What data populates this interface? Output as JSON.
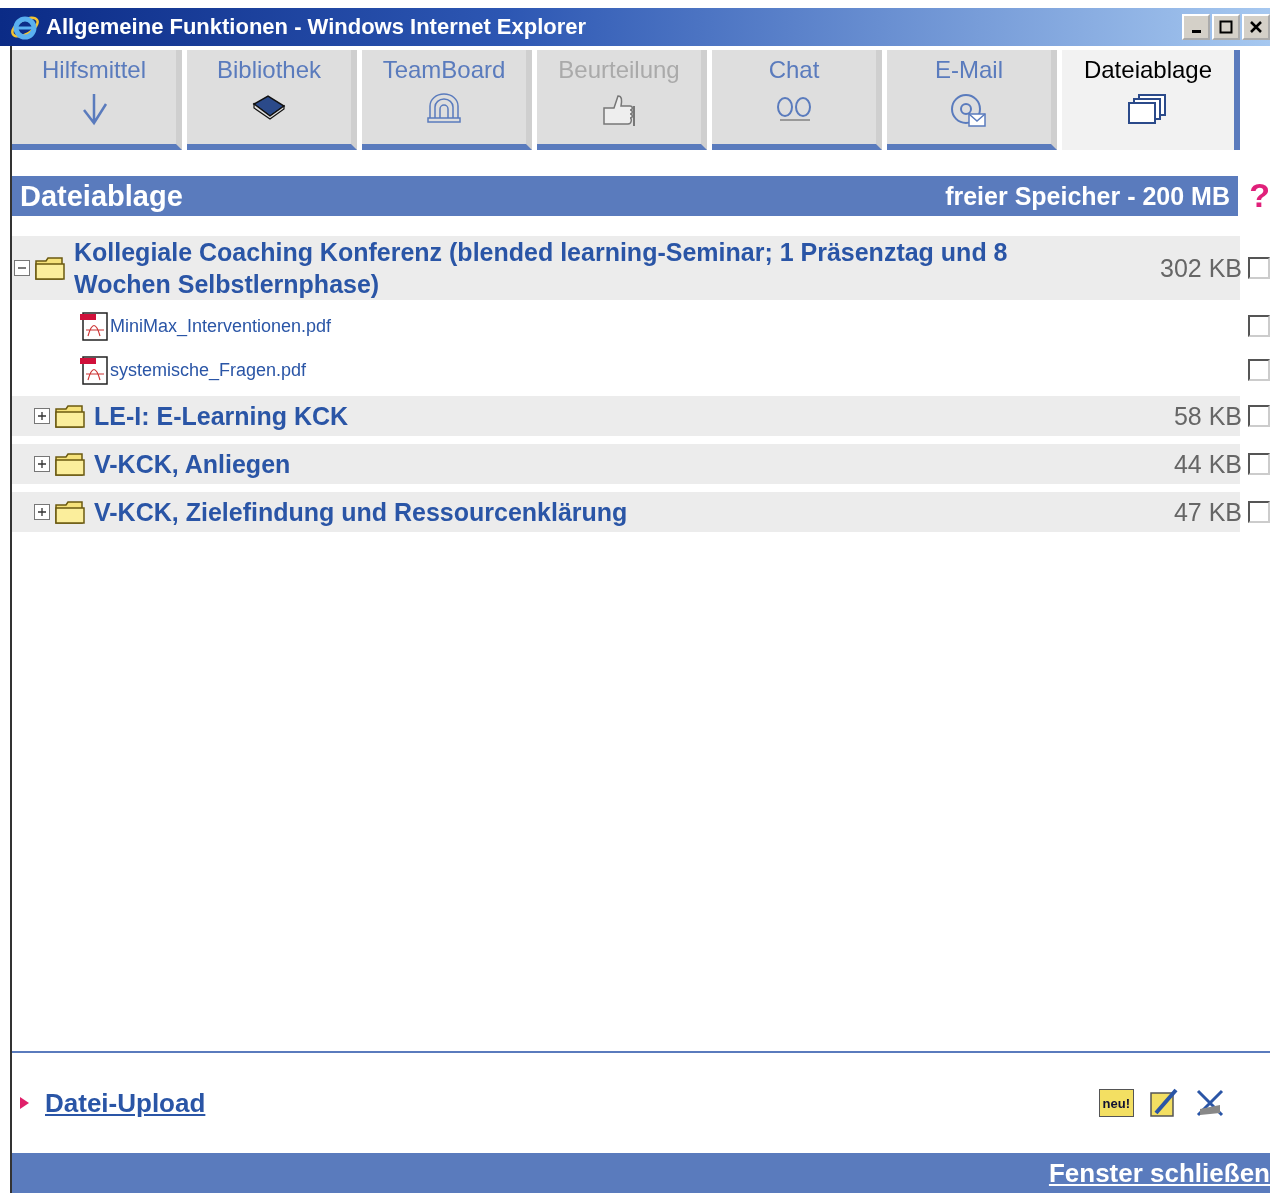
{
  "window": {
    "title": "Allgemeine Funktionen - Windows Internet Explorer"
  },
  "tabs": [
    {
      "label": "Hilfsmittel",
      "selected": false,
      "disabled": false
    },
    {
      "label": "Bibliothek",
      "selected": false,
      "disabled": false
    },
    {
      "label": "TeamBoard",
      "selected": false,
      "disabled": false
    },
    {
      "label": "Beurteilung",
      "selected": false,
      "disabled": true
    },
    {
      "label": "Chat",
      "selected": false,
      "disabled": false
    },
    {
      "label": "E-Mail",
      "selected": false,
      "disabled": false
    },
    {
      "label": "Dateiablage",
      "selected": true,
      "disabled": false
    }
  ],
  "header": {
    "title": "Dateiablage",
    "storage": "freier Speicher - 200 MB",
    "help": "?"
  },
  "tree": [
    {
      "kind": "folder",
      "title": "Kollegiale Coaching Konferenz (blended learning-Seminar; 1 Präsenztag und 8 Wochen Selbstlernphase)",
      "size": "302 KB",
      "expanded": true,
      "checked": false,
      "children": [
        {
          "kind": "file",
          "title": "MiniMax_Interventionen.pdf",
          "checked": false
        },
        {
          "kind": "file",
          "title": "systemische_Fragen.pdf",
          "checked": false
        }
      ]
    },
    {
      "kind": "folder",
      "title": "LE-I: E-Learning KCK",
      "size": "58 KB",
      "expanded": false,
      "checked": false
    },
    {
      "kind": "folder",
      "title": "V-KCK, Anliegen",
      "size": "44 KB",
      "expanded": false,
      "checked": false
    },
    {
      "kind": "folder",
      "title": "V-KCK, Zielefindung und Ressourcenklärung",
      "size": "47 KB",
      "expanded": false,
      "checked": false
    }
  ],
  "footer": {
    "upload_link": "Datei-Upload",
    "new_folder_label": "neu!",
    "close_link": "Fenster schließen"
  }
}
